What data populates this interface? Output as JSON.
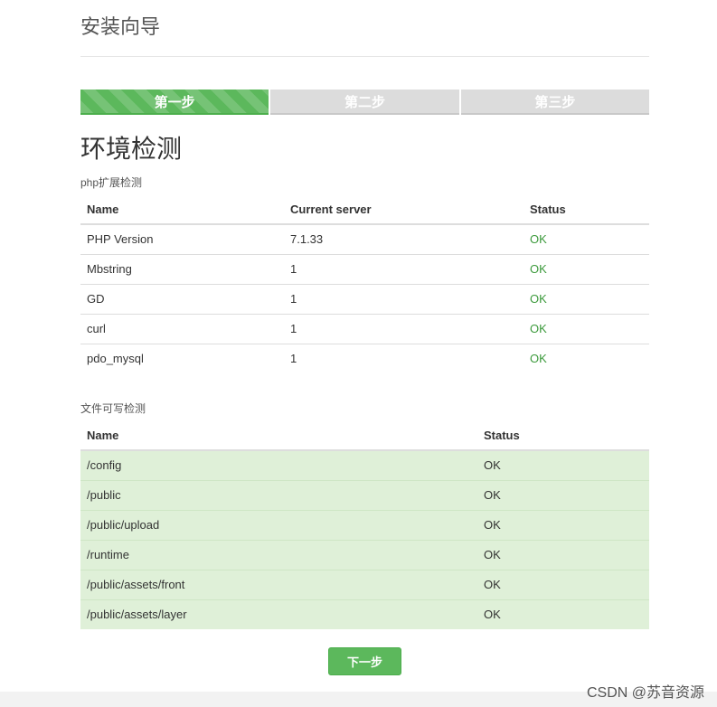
{
  "header": {
    "title": "安装向导"
  },
  "steps": [
    {
      "label": "第一步",
      "active": true
    },
    {
      "label": "第二步",
      "active": false
    },
    {
      "label": "第三步",
      "active": false
    }
  ],
  "section_title": "环境检测",
  "php_ext": {
    "heading": "php扩展检测",
    "columns": [
      "Name",
      "Current server",
      "Status"
    ],
    "rows": [
      {
        "name": "PHP Version",
        "current": "7.1.33",
        "status": "OK"
      },
      {
        "name": "Mbstring",
        "current": "1",
        "status": "OK"
      },
      {
        "name": "GD",
        "current": "1",
        "status": "OK"
      },
      {
        "name": "curl",
        "current": "1",
        "status": "OK"
      },
      {
        "name": "pdo_mysql",
        "current": "1",
        "status": "OK"
      }
    ]
  },
  "file_perm": {
    "heading": "文件可写检测",
    "columns": [
      "Name",
      "Status"
    ],
    "rows": [
      {
        "name": "/config",
        "status": "OK"
      },
      {
        "name": "/public",
        "status": "OK"
      },
      {
        "name": "/public/upload",
        "status": "OK"
      },
      {
        "name": "/runtime",
        "status": "OK"
      },
      {
        "name": "/public/assets/front",
        "status": "OK"
      },
      {
        "name": "/public/assets/layer",
        "status": "OK"
      }
    ]
  },
  "next_button": {
    "label": "下一步"
  },
  "watermark": "CSDN @苏音资源",
  "colors": {
    "accent": "#5cb85c",
    "ok_text": "#3c9a3c",
    "row_success": "#dff0d8"
  }
}
